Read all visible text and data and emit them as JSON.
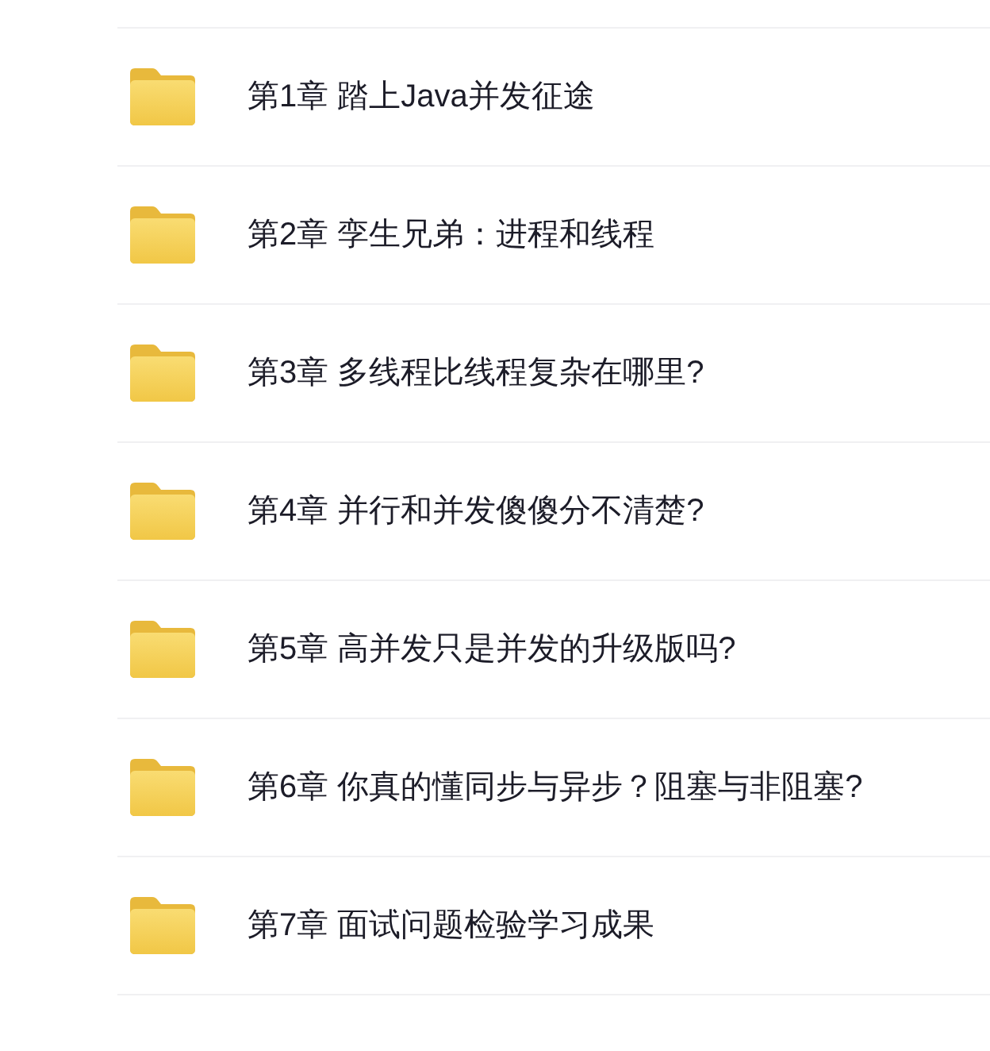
{
  "folders": [
    {
      "name": "第1章 踏上Java并发征途"
    },
    {
      "name": "第2章 孪生兄弟：进程和线程"
    },
    {
      "name": "第3章 多线程比线程复杂在哪里?"
    },
    {
      "name": "第4章 并行和并发傻傻分不清楚?"
    },
    {
      "name": "第5章 高并发只是并发的升级版吗?"
    },
    {
      "name": "第6章 你真的懂同步与异步？阻塞与非阻塞?"
    },
    {
      "name": "第7章 面试问题检验学习成果"
    }
  ]
}
